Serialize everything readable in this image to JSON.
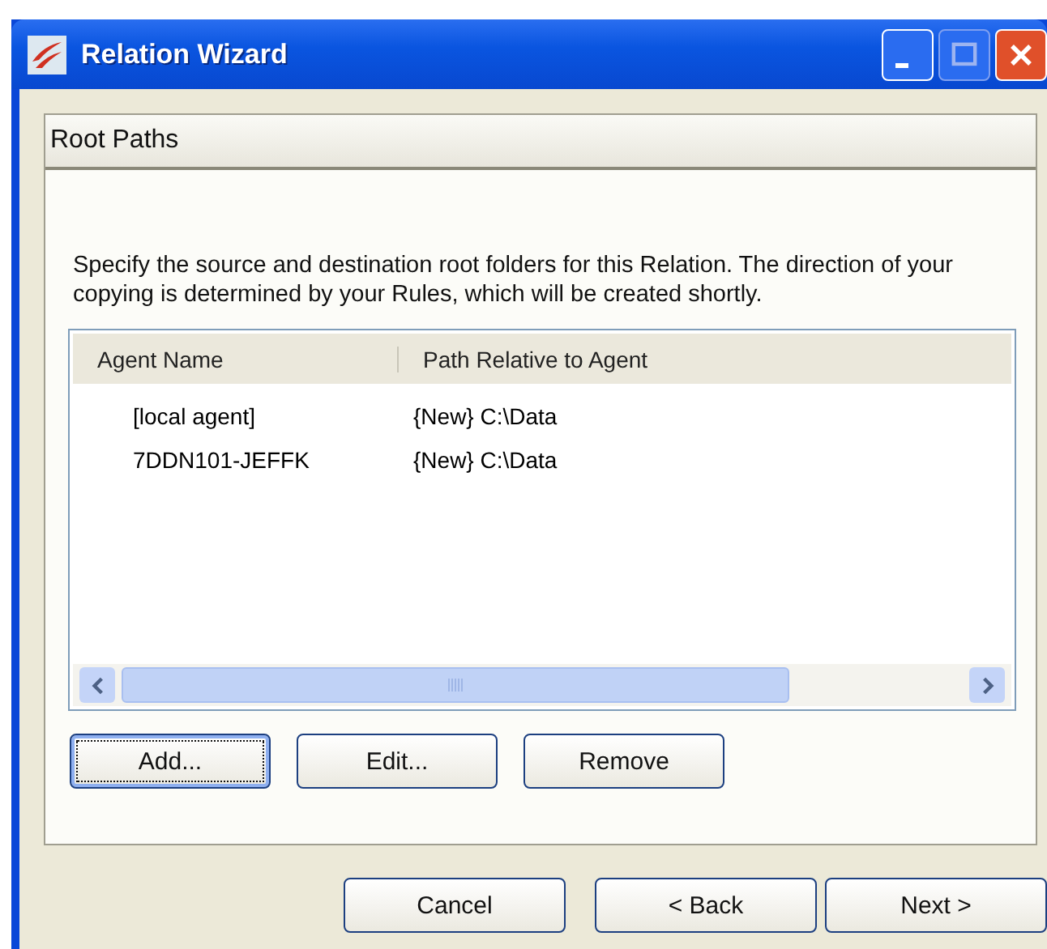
{
  "window": {
    "title": "Relation Wizard"
  },
  "page": {
    "heading": "Root Paths",
    "description": "Specify the source and destination root folders for this Relation. The direction of your copying is determined by your Rules, which will be created shortly."
  },
  "table": {
    "columns": [
      "Agent Name",
      "Path Relative to Agent"
    ],
    "rows": [
      [
        "[local agent]",
        "{New} C:\\Data"
      ],
      [
        "7DDN101-JEFFK",
        "{New} C:\\Data"
      ]
    ]
  },
  "list_buttons": [
    {
      "label": "Add...",
      "focused": true
    },
    {
      "label": "Edit...",
      "focused": false
    },
    {
      "label": "Remove",
      "focused": false
    }
  ],
  "footer_buttons": [
    "Cancel",
    "< Back",
    "Next >"
  ]
}
